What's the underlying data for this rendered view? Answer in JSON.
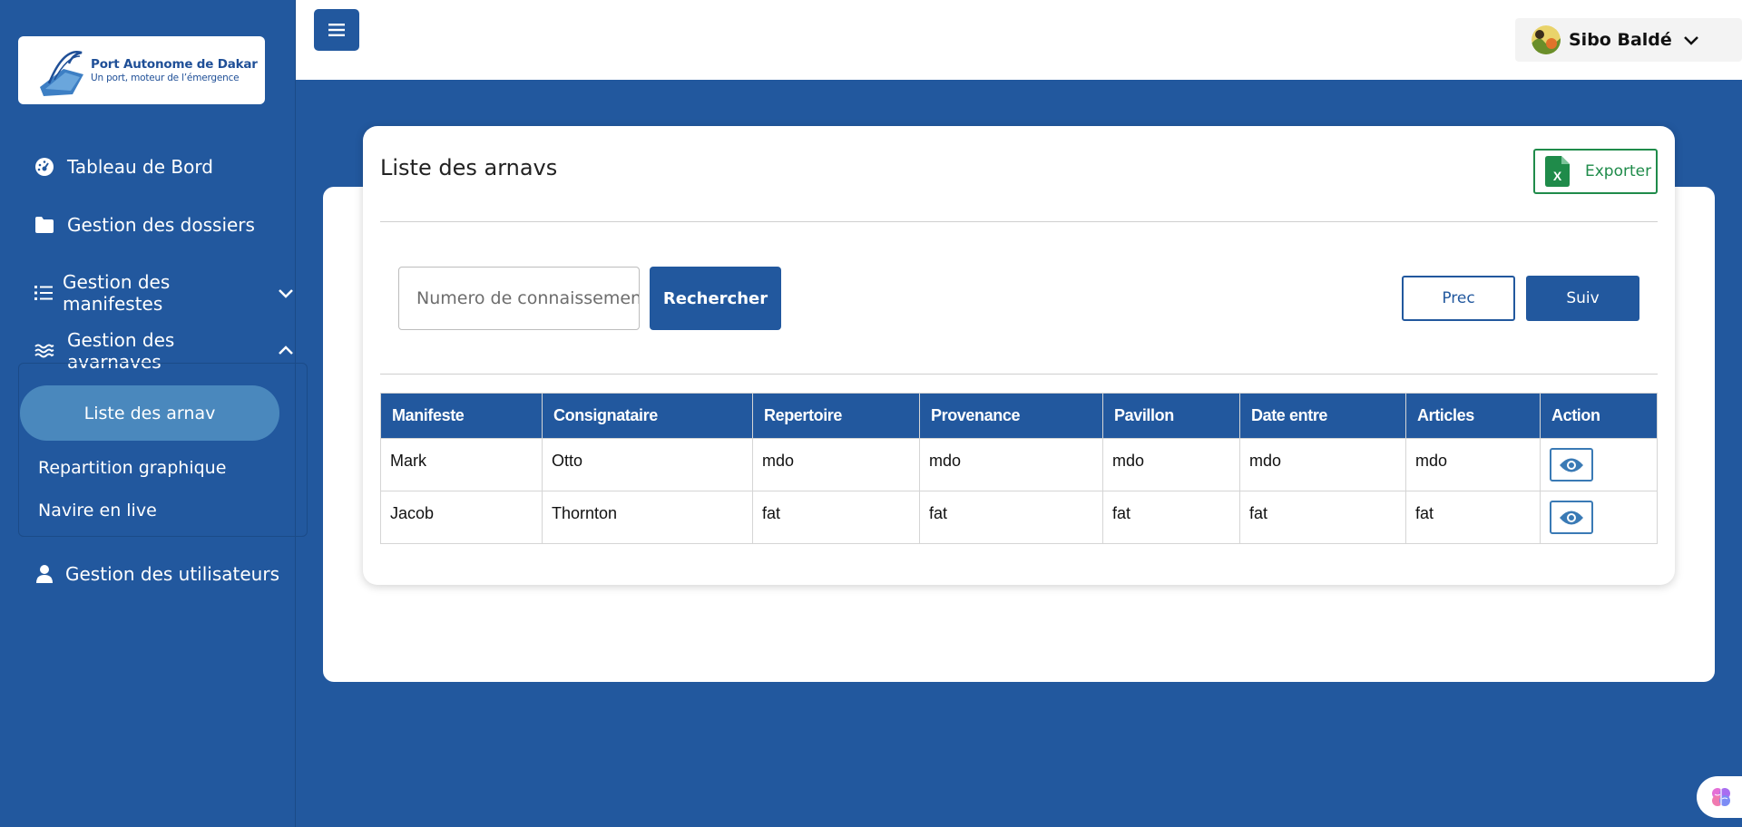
{
  "brand": {
    "title": "Port Autonome de Dakar",
    "subtitle": "Un port, moteur de l’émergence"
  },
  "sidebar": {
    "items": [
      {
        "label": "Tableau de Bord",
        "icon": "dashboard-icon"
      },
      {
        "label": "Gestion des dossiers",
        "icon": "folder-icon"
      },
      {
        "label": "Gestion des manifestes",
        "icon": "list-icon"
      },
      {
        "label": "Gestion des avarnaves",
        "icon": "water-icon"
      },
      {
        "label": "Gestion des utilisateurs",
        "icon": "user-icon"
      }
    ],
    "submenu": [
      "Liste des arnav",
      "Repartition graphique",
      "Navire en live"
    ]
  },
  "user": {
    "name": "Sibo Baldé"
  },
  "page": {
    "title": "Liste des arnavs",
    "export_label": "Exporter",
    "search_placeholder": "Numero de connaissement",
    "search_label": "Rechercher",
    "prev_label": "Prec",
    "next_label": "Suiv"
  },
  "table": {
    "headers": [
      "Manifeste",
      "Consignataire",
      "Repertoire",
      "Provenance",
      "Pavillon",
      "Date entre",
      "Articles",
      "Action"
    ],
    "rows": [
      [
        "Mark",
        "Otto",
        "mdo",
        "mdo",
        "mdo",
        "mdo",
        "mdo"
      ],
      [
        "Jacob",
        "Thornton",
        "fat",
        "fat",
        "fat",
        "fat",
        "fat"
      ]
    ]
  },
  "colors": {
    "primary": "#22589e",
    "active_submenu": "#4a88bd",
    "export_green": "#1f8b4a"
  }
}
